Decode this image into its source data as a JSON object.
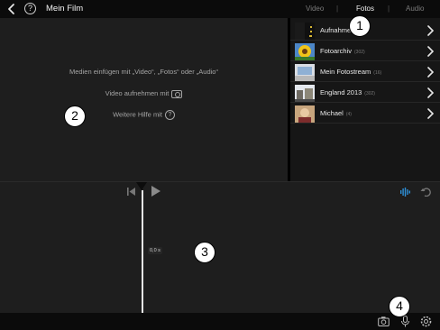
{
  "topbar": {
    "title": "Mein Film"
  },
  "tabs": [
    {
      "label": "Video",
      "active": false
    },
    {
      "label": "Fotos",
      "active": true
    },
    {
      "label": "Audio",
      "active": false
    }
  ],
  "tab_separator": "|",
  "viewer": {
    "insert_hint": "Medien einfügen mit „Video“, „Fotos“ oder „Audio“",
    "record_hint": "Video aufnehmen mit",
    "help_hint": "Weitere Hilfe mit"
  },
  "albums": [
    {
      "label": "Aufnahmen",
      "count": ""
    },
    {
      "label": "Fotoarchiv",
      "count": "(302)"
    },
    {
      "label": "Mein Fotostream",
      "count": "(16)"
    },
    {
      "label": "England 2013",
      "count": "(302)"
    },
    {
      "label": "Michael",
      "count": "(4)"
    }
  ],
  "timeline": {
    "timecode": "0,0 s"
  },
  "callouts": [
    "1",
    "2",
    "3",
    "4"
  ],
  "icons": {
    "back": "chevron-left-icon",
    "help": "question-circle-icon",
    "album_chevron": "chevron-right-icon",
    "rewind": "skip-to-start-icon",
    "play": "play-icon",
    "waveform": "audio-waveform-icon",
    "undo": "undo-icon",
    "camera": "camera-icon",
    "microphone": "microphone-icon",
    "settings": "gear-icon"
  },
  "colors": {
    "accent": "#2e8fd6",
    "viewer_bg": "#1e1e1e",
    "bar_bg": "#0b0b0b"
  }
}
